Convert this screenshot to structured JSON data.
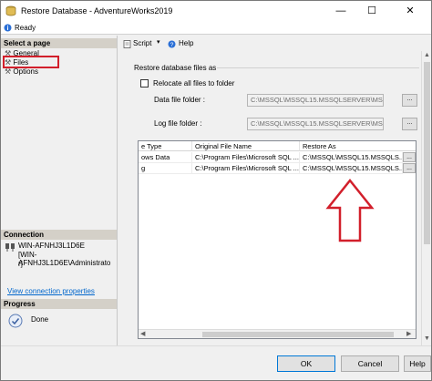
{
  "window": {
    "title": "Restore Database - AdventureWorks2019",
    "status": "Ready"
  },
  "left": {
    "select_page_heading": "Select a page",
    "pages": [
      "General",
      "Files",
      "Options"
    ],
    "connection_heading": "Connection",
    "server": "WIN-AFNHJ3L1D6E",
    "user": "[WIN-AFNHJ3L1D6E\\Administrato",
    "user_cont": "r]",
    "view_connection_link": "View connection properties",
    "progress_heading": "Progress",
    "progress_status": "Done"
  },
  "toolbar": {
    "script_label": "Script",
    "help_label": "Help"
  },
  "files": {
    "section_label": "Restore database files as",
    "relocate_label": "Relocate all files to folder",
    "relocate_checked": false,
    "data_folder_label": "Data file folder :",
    "data_folder_value": "C:\\MSSQL\\MSSQL15.MSSQLSERVER\\MSS",
    "log_folder_label": "Log file folder :",
    "log_folder_value": "C:\\MSSQL\\MSSQL15.MSSQLSERVER\\MSS",
    "browse_label": "..."
  },
  "grid": {
    "columns": [
      "e Type",
      "Original File Name",
      "Restore As"
    ],
    "rows": [
      {
        "type": "ows Data",
        "original": "C:\\Program Files\\Microsoft SQL ...",
        "restore_as": "C:\\MSSQL\\MSSQL15.MSSQLS..."
      },
      {
        "type": "g",
        "original": "C:\\Program Files\\Microsoft SQL ...",
        "restore_as": "C:\\MSSQL\\MSSQL15.MSSQLS..."
      }
    ]
  },
  "buttons": {
    "ok": "OK",
    "cancel": "Cancel",
    "help": "Help"
  },
  "colors": {
    "highlight_box": "#d21f2b",
    "arrow": "#d21f2b",
    "link": "#0066cc"
  }
}
